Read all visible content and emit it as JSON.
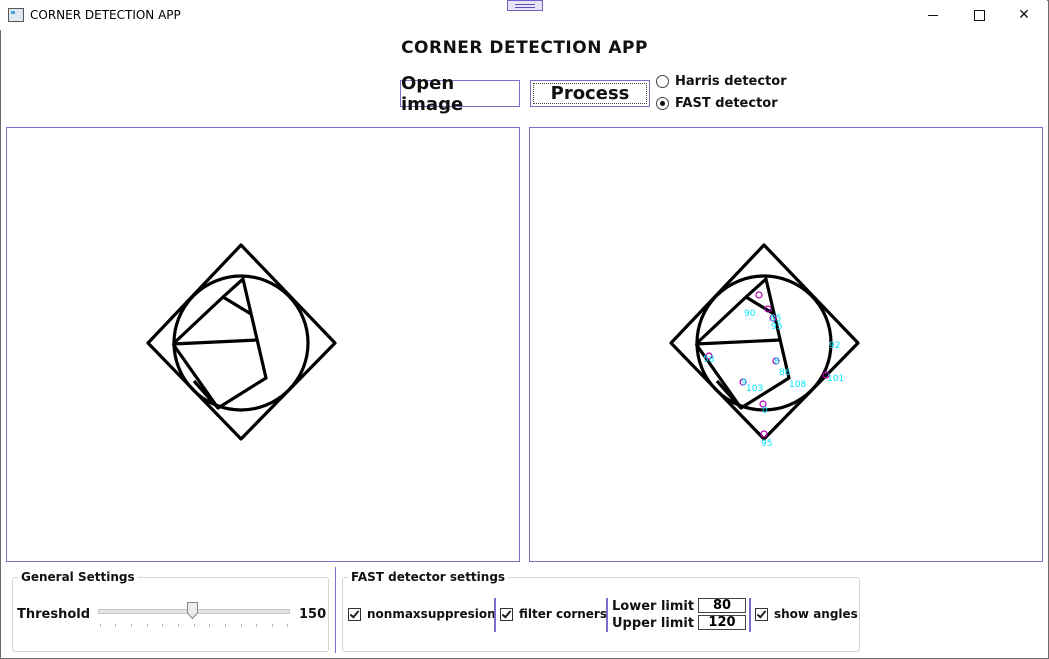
{
  "window": {
    "title": "CORNER DETECTION APP"
  },
  "header": {
    "title": "CORNER DETECTION APP"
  },
  "toolbar": {
    "open_label": "Open image",
    "process_label": "Process",
    "detectors": [
      {
        "label": "Harris detector",
        "selected": false
      },
      {
        "label": "FAST detector",
        "selected": true
      }
    ]
  },
  "result_labels": [
    "90",
    "85",
    "95",
    "58",
    "8",
    "86",
    "108",
    "92",
    "9",
    "101",
    "103",
    "0",
    "95"
  ],
  "general_settings": {
    "legend": "General Settings",
    "threshold_label": "Threshold",
    "threshold_value": "150",
    "threshold_position": 0.5
  },
  "fast_settings": {
    "legend": "FAST detector settings",
    "nonmax_label": "nonmaxsuppresion",
    "nonmax_checked": true,
    "filter_label": "filter corners",
    "filter_checked": true,
    "lower_label": "Lower limit",
    "lower_value": "80",
    "upper_label": "Upper limit",
    "upper_value": "120",
    "angles_label": "show angles",
    "angles_checked": true
  },
  "colors": {
    "accent": "#7a70c8",
    "corner_label": "#00e5ff",
    "corner_marker": "#b000b0"
  }
}
